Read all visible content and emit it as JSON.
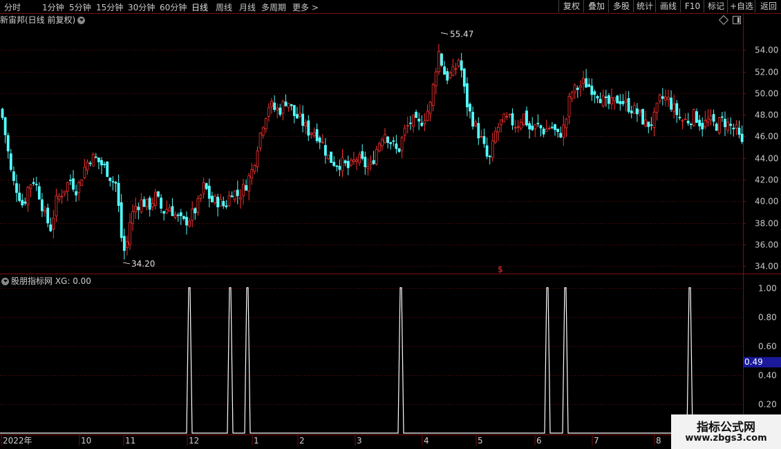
{
  "toolbar": {
    "periods": [
      "分时",
      "1分钟",
      "5分钟",
      "15分钟",
      "30分钟",
      "60分钟",
      "日线",
      "周线",
      "月线",
      "多周期",
      "更多 >"
    ],
    "active_period": "日线",
    "buttons": [
      "复权",
      "叠加",
      "多股",
      "统计",
      "画线",
      "F10",
      "标记",
      "+自选",
      "返回"
    ]
  },
  "stock_title": "新宙邦(日线 前复权)",
  "indicator_title": "股朋指标网 XG: 0.00",
  "watermark": {
    "line1": "指标公式网",
    "line2": "www.zbgs3.com"
  },
  "colors": {
    "up": "#ff3232",
    "down": "#54ffff",
    "grid": "#7a1010",
    "axis_text": "#c8c8c8",
    "signal": "#ffffff",
    "marker": "#1a1a9a"
  },
  "chart_data": [
    {
      "type": "candlestick",
      "title": "新宙邦(日线 前复权)",
      "ylim": [
        33.3,
        56.2
      ],
      "yticks": [
        34.0,
        36.0,
        38.0,
        40.0,
        42.0,
        44.0,
        46.0,
        48.0,
        50.0,
        52.0,
        54.0
      ],
      "ytick_labels": [
        "34.00",
        "36.00",
        "38.00",
        "40.00",
        "42.00",
        "44.00",
        "46.00",
        "48.00",
        "50.00",
        "52.00",
        "54.00"
      ],
      "annotations": [
        {
          "label": "55.47",
          "value": 55.47
        },
        {
          "label": "34.20",
          "value": 34.2
        }
      ],
      "approx_close_path": [
        [
          0,
          48.5
        ],
        [
          8,
          45.5
        ],
        [
          16,
          42.0
        ],
        [
          24,
          41.0
        ],
        [
          32,
          39.5
        ],
        [
          40,
          41.5
        ],
        [
          48,
          42.0
        ],
        [
          56,
          40.5
        ],
        [
          64,
          38.5
        ],
        [
          72,
          37.5
        ],
        [
          80,
          40.0
        ],
        [
          90,
          41.0
        ],
        [
          100,
          42.0
        ],
        [
          110,
          41.0
        ],
        [
          120,
          43.0
        ],
        [
          128,
          44.0
        ],
        [
          136,
          44.0
        ],
        [
          144,
          43.5
        ],
        [
          152,
          43.0
        ],
        [
          160,
          42.0
        ],
        [
          168,
          41.5
        ],
        [
          172,
          37.5
        ],
        [
          176,
          36.0
        ],
        [
          180,
          35.0
        ],
        [
          186,
          38.0
        ],
        [
          194,
          39.5
        ],
        [
          204,
          40.0
        ],
        [
          214,
          39.5
        ],
        [
          224,
          40.5
        ],
        [
          234,
          39.0
        ],
        [
          244,
          39.5
        ],
        [
          254,
          38.5
        ],
        [
          264,
          38.0
        ],
        [
          274,
          38.5
        ],
        [
          284,
          39.5
        ],
        [
          294,
          41.5
        ],
        [
          304,
          40.0
        ],
        [
          314,
          40.0
        ],
        [
          324,
          39.5
        ],
        [
          334,
          41.0
        ],
        [
          344,
          40.5
        ],
        [
          354,
          41.5
        ],
        [
          364,
          43.0
        ],
        [
          372,
          45.5
        ],
        [
          380,
          47.5
        ],
        [
          388,
          49.0
        ],
        [
          396,
          48.5
        ],
        [
          404,
          48.5
        ],
        [
          414,
          49.5
        ],
        [
          424,
          48.0
        ],
        [
          434,
          47.5
        ],
        [
          444,
          46.5
        ],
        [
          454,
          46.5
        ],
        [
          464,
          45.5
        ],
        [
          474,
          44.0
        ],
        [
          484,
          43.5
        ],
        [
          494,
          43.5
        ],
        [
          504,
          43.0
        ],
        [
          514,
          44.0
        ],
        [
          524,
          43.5
        ],
        [
          534,
          43.0
        ],
        [
          544,
          45.0
        ],
        [
          554,
          46.5
        ],
        [
          564,
          45.5
        ],
        [
          574,
          44.5
        ],
        [
          584,
          46.5
        ],
        [
          594,
          47.5
        ],
        [
          604,
          47.0
        ],
        [
          614,
          48.0
        ],
        [
          622,
          49.0
        ],
        [
          628,
          52.0
        ],
        [
          634,
          54.0
        ],
        [
          640,
          52.0
        ],
        [
          646,
          51.5
        ],
        [
          656,
          52.0
        ],
        [
          664,
          53.5
        ],
        [
          668,
          51.0
        ],
        [
          676,
          48.5
        ],
        [
          686,
          47.0
        ],
        [
          696,
          45.5
        ],
        [
          706,
          43.5
        ],
        [
          716,
          46.5
        ],
        [
          726,
          47.5
        ],
        [
          736,
          47.5
        ],
        [
          746,
          47.0
        ],
        [
          756,
          48.0
        ],
        [
          766,
          46.5
        ],
        [
          776,
          47.0
        ],
        [
          786,
          46.5
        ],
        [
          796,
          47.0
        ],
        [
          806,
          46.0
        ],
        [
          816,
          47.0
        ],
        [
          824,
          50.0
        ],
        [
          834,
          50.5
        ],
        [
          844,
          51.0
        ],
        [
          854,
          50.5
        ],
        [
          864,
          50.0
        ],
        [
          874,
          49.0
        ],
        [
          884,
          49.0
        ],
        [
          894,
          49.5
        ],
        [
          904,
          49.0
        ],
        [
          914,
          48.5
        ],
        [
          924,
          48.0
        ],
        [
          934,
          47.0
        ],
        [
          944,
          47.5
        ],
        [
          954,
          49.5
        ],
        [
          964,
          49.5
        ],
        [
          974,
          48.5
        ],
        [
          984,
          47.5
        ],
        [
          994,
          47.5
        ],
        [
          1004,
          48.0
        ],
        [
          1014,
          47.0
        ],
        [
          1024,
          47.5
        ],
        [
          1034,
          47.0
        ],
        [
          1044,
          47.5
        ],
        [
          1054,
          47.0
        ],
        [
          1064,
          46.5
        ],
        [
          1070,
          45.5
        ],
        [
          1076,
          44.5
        ]
      ]
    },
    {
      "type": "line",
      "title": "股朋指标网 XG: 0.00",
      "series_name": "XG",
      "ylim": [
        0,
        1.05
      ],
      "yticks": [
        0.2,
        0.4,
        0.6,
        0.8,
        1.0
      ],
      "ytick_labels": [
        "0.20",
        "0.40",
        "0.60",
        "0.80",
        "1.00"
      ],
      "current_value_label": "0.49",
      "current_value": 0.49,
      "spikes_at": [
        274,
        333,
        358,
        580,
        792,
        818,
        998
      ],
      "spike_value": 1.0,
      "baseline_value": 0.0
    }
  ],
  "x_axis": {
    "labels": [
      "2022年",
      "10",
      "11",
      "12",
      "1",
      "2",
      "3",
      "4",
      "5",
      "6",
      "7",
      "8"
    ],
    "label_positions": [
      3,
      116,
      180,
      272,
      366,
      432,
      515,
      612,
      690,
      775,
      858,
      948
    ]
  }
}
